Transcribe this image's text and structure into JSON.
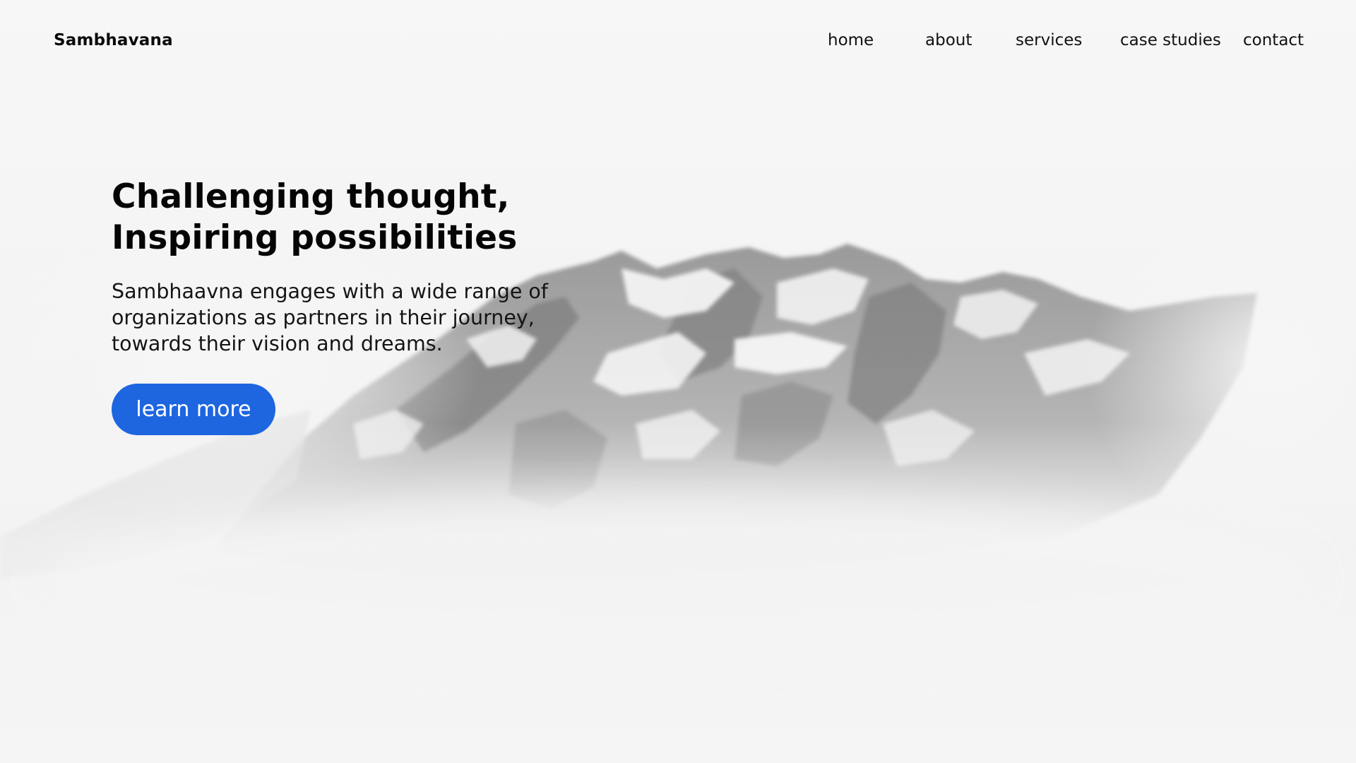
{
  "header": {
    "brand": "Sambhavana",
    "nav": [
      {
        "label": "home"
      },
      {
        "label": "about"
      },
      {
        "label": "services"
      },
      {
        "label": "case studies"
      },
      {
        "label": "contact"
      }
    ]
  },
  "hero": {
    "title_line1": "Challenging thought,",
    "title_line2": "Inspiring possibilities",
    "description_line1": "Sambhaavna engages with a wide range of",
    "description_line2": "organizations as partners in their journey,",
    "description_line3": "towards their vision and dreams.",
    "cta_label": "learn more"
  },
  "colors": {
    "accent": "#1e66e0",
    "text": "#0b0b0b",
    "background": "#f5f5f5"
  }
}
